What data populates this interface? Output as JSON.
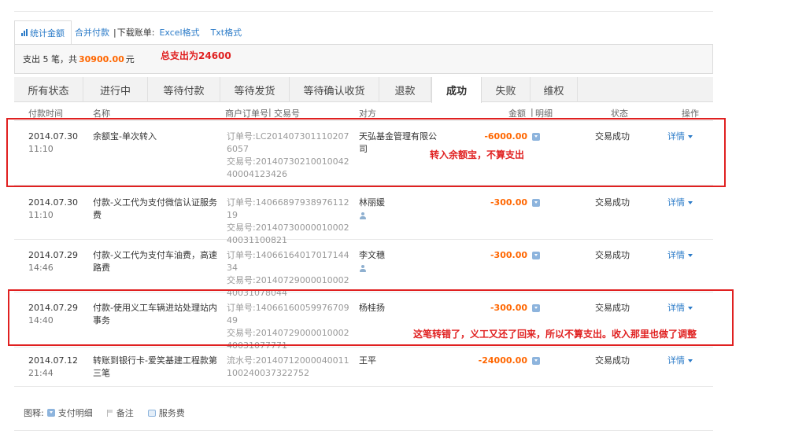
{
  "toolbar": {
    "stats_label": "统计金额",
    "merge_pay_label": "合并付款",
    "download_label": "下载账单:",
    "excel_label": "Excel格式",
    "txt_label": "Txt格式"
  },
  "summary": {
    "prefix": "支出 5 笔，共",
    "amount": "30900.00",
    "unit": "元"
  },
  "annotations": {
    "total_note": "总支出为24600",
    "yuebao_note": "转入余额宝，不算支出",
    "refund_note": "这笔转错了，义工又还了回来，所以不算支出。收入那里也做了调整",
    "color": "#e02020"
  },
  "tabs": [
    {
      "label": "所有状态",
      "active": false
    },
    {
      "label": "进行中",
      "active": false
    },
    {
      "label": "等待付款",
      "active": false
    },
    {
      "label": "等待发货",
      "active": false
    },
    {
      "label": "等待确认收货",
      "active": false
    },
    {
      "label": "退款",
      "active": false
    },
    {
      "label": "成功",
      "active": true
    },
    {
      "label": "失败",
      "active": false
    },
    {
      "label": "维权",
      "active": false
    }
  ],
  "columns": {
    "time": "付款时间",
    "name": "名称",
    "order": "商户订单号",
    "trade": "交易号",
    "party": "对方",
    "amount": "金额",
    "detail": "明细",
    "status": "状态",
    "action": "操作"
  },
  "rows": [
    {
      "date": "2014.07.30",
      "time": "11:10",
      "name": "余额宝-单次转入",
      "id1": "订单号:LC2014073011102076057",
      "id2": "交易号:2014073021001004240004123426",
      "party": "天弘基金管理有限公司",
      "amount": "-6000.00",
      "status": "交易成功",
      "action": "详情"
    },
    {
      "date": "2014.07.30",
      "time": "11:10",
      "name": "付款-义工代为支付微信认证服务费",
      "id1": "订单号:1406689793897611219",
      "id2": "交易号:2014073000001000240031100821",
      "party": "林丽媛",
      "amount": "-300.00",
      "status": "交易成功",
      "action": "详情"
    },
    {
      "date": "2014.07.29",
      "time": "14:46",
      "name": "付款-义工代为支付车油费，高速路费",
      "id1": "订单号:1406616401701714434",
      "id2": "交易号:2014072900001000240031078044",
      "party": "李文穗",
      "amount": "-300.00",
      "status": "交易成功",
      "action": "详情"
    },
    {
      "date": "2014.07.29",
      "time": "14:40",
      "name": "付款-使用义工车辆进站处理站内事务",
      "id1": "订单号:1406616005997670949",
      "id2": "交易号:2014072900001000240031077771",
      "party": "杨桂扬",
      "amount": "-300.00",
      "status": "交易成功",
      "action": "详情"
    },
    {
      "date": "2014.07.12",
      "time": "21:44",
      "name": "转账到银行卡-爱笑基建工程款第三笔",
      "id1": "流水号:20140712000040011100240037322752",
      "id2": "",
      "party": "王平",
      "amount": "-24000.00",
      "status": "交易成功",
      "action": "详情"
    }
  ],
  "legend": {
    "title": "图释:",
    "pay_detail": "支付明细",
    "remark": "备注",
    "service_fee": "服务费"
  }
}
